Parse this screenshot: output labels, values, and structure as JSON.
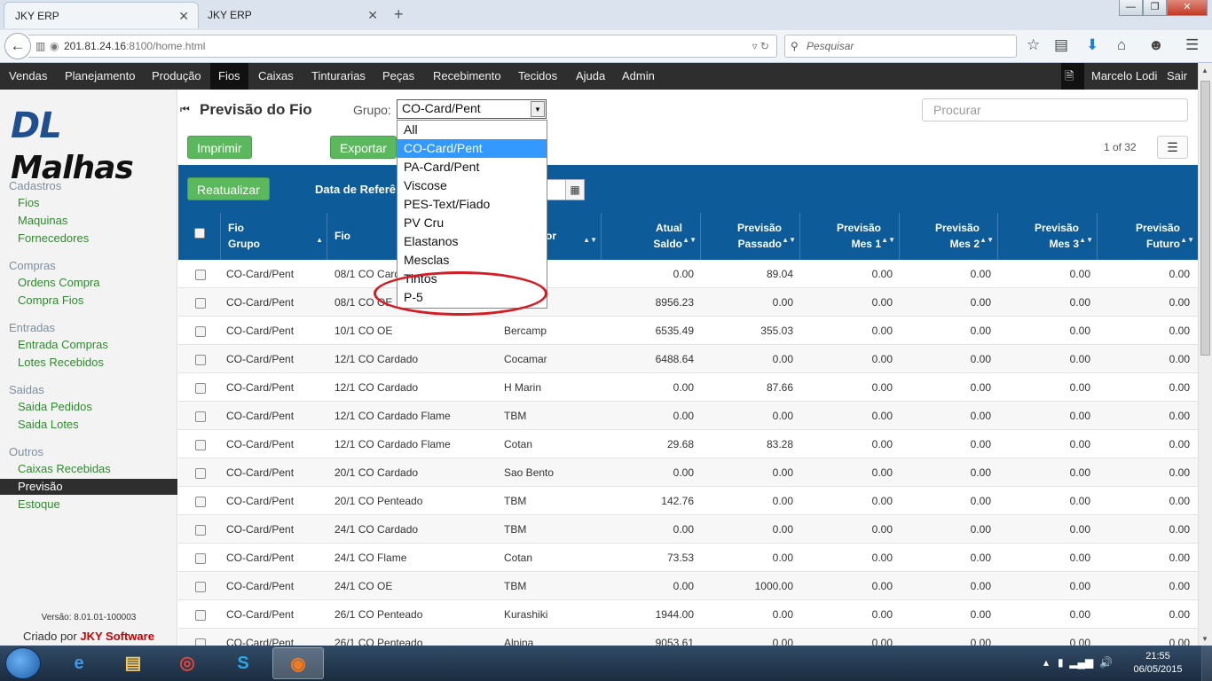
{
  "browser": {
    "tabs": [
      {
        "label": "JKY ERP"
      },
      {
        "label": "JKY ERP"
      }
    ],
    "url_host": "201.81.24.16",
    "url_rest": ":8100/home.html",
    "search_placeholder": "Pesquisar",
    "window_buttons": {
      "minimize": "—",
      "maximize": "❐",
      "close": "✕"
    }
  },
  "nav": {
    "items": [
      "Vendas",
      "Planejamento",
      "Produção",
      "Fios",
      "Caixas",
      "Tinturarias",
      "Peças",
      "Recebimento",
      "Tecidos",
      "Ajuda",
      "Admin"
    ],
    "active": "Fios",
    "user": "Marcelo Lodi",
    "logout": "Sair"
  },
  "sidebar": {
    "logo_dl": "DL",
    "logo_rest": "Malhas",
    "sections": [
      {
        "title": "Cadastros",
        "items": [
          "Fios",
          "Maquinas",
          "Fornecedores"
        ]
      },
      {
        "title": "Compras",
        "items": [
          "Ordens Compra",
          "Compra Fios"
        ]
      },
      {
        "title": "Entradas",
        "items": [
          "Entrada Compras",
          "Lotes Recebidos"
        ]
      },
      {
        "title": "Saidas",
        "items": [
          "Saida Pedidos",
          "Saida Lotes"
        ]
      },
      {
        "title": "Outros",
        "items": [
          "Caixas Recebidas",
          "Previsão",
          "Estoque"
        ]
      }
    ],
    "active_item": "Previsão",
    "version": "Versão: 8.01.01-100003",
    "credit_prefix": "Criado por",
    "credit_brand": "JKY Software"
  },
  "page": {
    "title": "Previsão do Fio",
    "grupo_label": "Grupo:",
    "grupo_value": "CO-Card/Pent",
    "search_placeholder": "Procurar",
    "imprimir": "Imprimir",
    "exportar": "Exportar",
    "reatualizar": "Reatualizar",
    "data_label": "Data de Referê",
    "pager": "1 of 32"
  },
  "dropdown": {
    "options": [
      "All",
      "CO-Card/Pent",
      "PA-Card/Pent",
      "Viscose",
      "PES-Text/Fiado",
      "PV Cru",
      "Elastanos",
      "Mesclas",
      "Tintos",
      "P-5"
    ],
    "selected": "CO-Card/Pent"
  },
  "table": {
    "headers": {
      "grupo": [
        "Fio",
        "Grupo"
      ],
      "fio": [
        "Fio"
      ],
      "fornecedor": [
        "or"
      ],
      "saldo": [
        "Atual",
        "Saldo"
      ],
      "passado": [
        "Previsão",
        "Passado"
      ],
      "mes1": [
        "Previsão",
        "Mes 1"
      ],
      "mes2": [
        "Previsão",
        "Mes 2"
      ],
      "mes3": [
        "Previsão",
        "Mes 3"
      ],
      "futuro": [
        "Previsão",
        "Futuro"
      ]
    },
    "rows": [
      {
        "grupo": "CO-Card/Pent",
        "fio": "08/1 CO Card",
        "forn": "",
        "saldo": "0.00",
        "passado": "89.04",
        "mes1": "0.00",
        "mes2": "0.00",
        "mes3": "0.00",
        "futuro": "0.00"
      },
      {
        "grupo": "CO-Card/Pent",
        "fio": "08/1 CO OE",
        "forn": "",
        "saldo": "8956.23",
        "passado": "0.00",
        "mes1": "0.00",
        "mes2": "0.00",
        "mes3": "0.00",
        "futuro": "0.00"
      },
      {
        "grupo": "CO-Card/Pent",
        "fio": "10/1 CO OE",
        "forn": "Bercamp",
        "saldo": "6535.49",
        "passado": "355.03",
        "mes1": "0.00",
        "mes2": "0.00",
        "mes3": "0.00",
        "futuro": "0.00"
      },
      {
        "grupo": "CO-Card/Pent",
        "fio": "12/1 CO Cardado",
        "forn": "Cocamar",
        "saldo": "6488.64",
        "passado": "0.00",
        "mes1": "0.00",
        "mes2": "0.00",
        "mes3": "0.00",
        "futuro": "0.00"
      },
      {
        "grupo": "CO-Card/Pent",
        "fio": "12/1 CO Cardado",
        "forn": "H Marin",
        "saldo": "0.00",
        "passado": "87.66",
        "mes1": "0.00",
        "mes2": "0.00",
        "mes3": "0.00",
        "futuro": "0.00"
      },
      {
        "grupo": "CO-Card/Pent",
        "fio": "12/1 CO Cardado Flame",
        "forn": "TBM",
        "saldo": "0.00",
        "passado": "0.00",
        "mes1": "0.00",
        "mes2": "0.00",
        "mes3": "0.00",
        "futuro": "0.00"
      },
      {
        "grupo": "CO-Card/Pent",
        "fio": "12/1 CO Cardado Flame",
        "forn": "Cotan",
        "saldo": "29.68",
        "passado": "83.28",
        "mes1": "0.00",
        "mes2": "0.00",
        "mes3": "0.00",
        "futuro": "0.00"
      },
      {
        "grupo": "CO-Card/Pent",
        "fio": "20/1 CO Cardado",
        "forn": "Sao Bento",
        "saldo": "0.00",
        "passado": "0.00",
        "mes1": "0.00",
        "mes2": "0.00",
        "mes3": "0.00",
        "futuro": "0.00"
      },
      {
        "grupo": "CO-Card/Pent",
        "fio": "20/1 CO Penteado",
        "forn": "TBM",
        "saldo": "142.76",
        "passado": "0.00",
        "mes1": "0.00",
        "mes2": "0.00",
        "mes3": "0.00",
        "futuro": "0.00"
      },
      {
        "grupo": "CO-Card/Pent",
        "fio": "24/1 CO Cardado",
        "forn": "TBM",
        "saldo": "0.00",
        "passado": "0.00",
        "mes1": "0.00",
        "mes2": "0.00",
        "mes3": "0.00",
        "futuro": "0.00"
      },
      {
        "grupo": "CO-Card/Pent",
        "fio": "24/1 CO Flame",
        "forn": "Cotan",
        "saldo": "73.53",
        "passado": "0.00",
        "mes1": "0.00",
        "mes2": "0.00",
        "mes3": "0.00",
        "futuro": "0.00"
      },
      {
        "grupo": "CO-Card/Pent",
        "fio": "24/1 CO OE",
        "forn": "TBM",
        "saldo": "0.00",
        "passado": "1000.00",
        "mes1": "0.00",
        "mes2": "0.00",
        "mes3": "0.00",
        "futuro": "0.00"
      },
      {
        "grupo": "CO-Card/Pent",
        "fio": "26/1 CO Penteado",
        "forn": "Kurashiki",
        "saldo": "1944.00",
        "passado": "0.00",
        "mes1": "0.00",
        "mes2": "0.00",
        "mes3": "0.00",
        "futuro": "0.00"
      },
      {
        "grupo": "CO-Card/Pent",
        "fio": "26/1 CO Penteado",
        "forn": "Alpina",
        "saldo": "9053.61",
        "passado": "0.00",
        "mes1": "0.00",
        "mes2": "0.00",
        "mes3": "0.00",
        "futuro": "0.00"
      }
    ]
  },
  "taskbar": {
    "apps": [
      "ie-icon",
      "explorer-icon",
      "chrome-icon",
      "skype-icon",
      "firefox-icon"
    ],
    "active_app": "firefox-icon",
    "time": "21:55",
    "date": "06/05/2015"
  },
  "colors": {
    "accent_blue": "#0e5b9a",
    "green": "#5cb85c",
    "nav_dark": "#2e2e2e",
    "annotation_red": "#d41c24",
    "link_green": "#2f8a2f"
  }
}
